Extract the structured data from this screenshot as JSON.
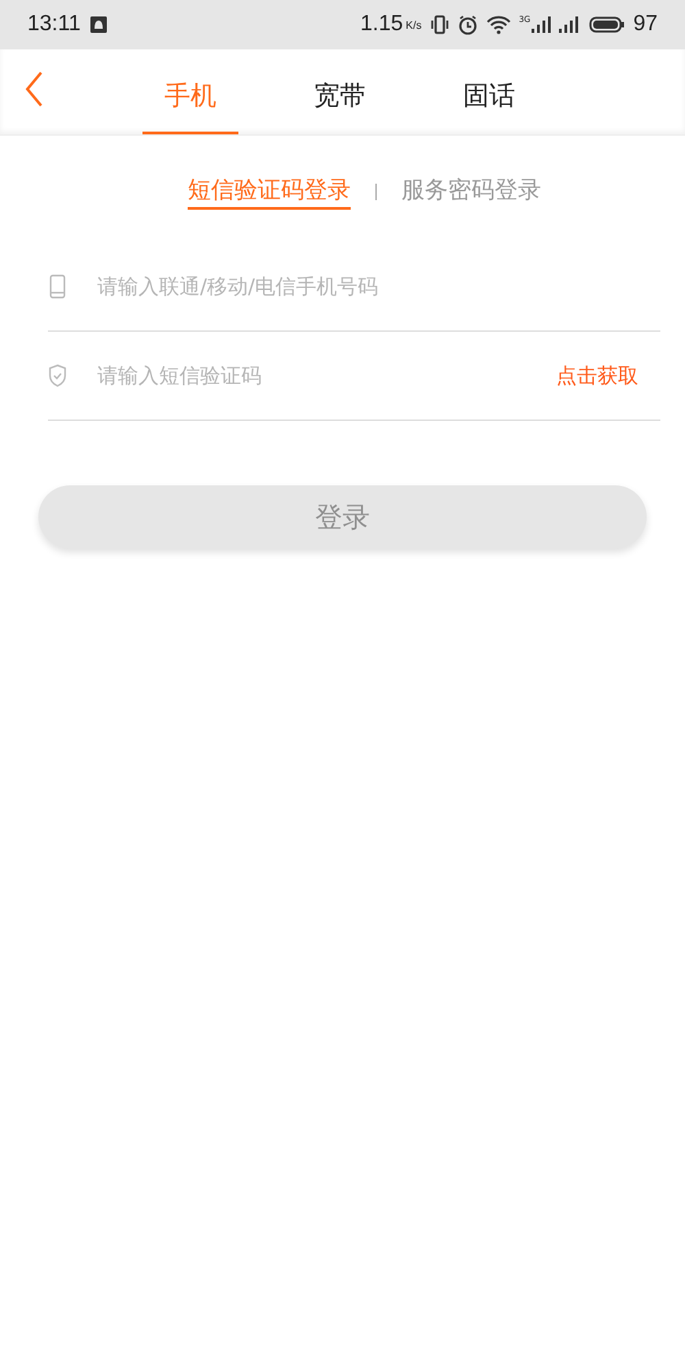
{
  "status_bar": {
    "time": "13:11",
    "speed": "1.15",
    "speed_unit": "K/s",
    "network_type": "3G",
    "battery": "97"
  },
  "tabs": [
    {
      "label": "手机",
      "selected": true
    },
    {
      "label": "宽带",
      "selected": false
    },
    {
      "label": "固话",
      "selected": false
    }
  ],
  "login_modes": [
    {
      "label": "短信验证码登录",
      "selected": true
    },
    {
      "label": "服务密码登录",
      "selected": false
    }
  ],
  "fields": [
    {
      "kind": "phone",
      "placeholder": "请输入联通/移动/电信手机号码"
    },
    {
      "kind": "code",
      "placeholder": "请输入短信验证码",
      "action": "点击获取"
    }
  ],
  "login_button": {
    "label": "登录",
    "disabled": true
  }
}
